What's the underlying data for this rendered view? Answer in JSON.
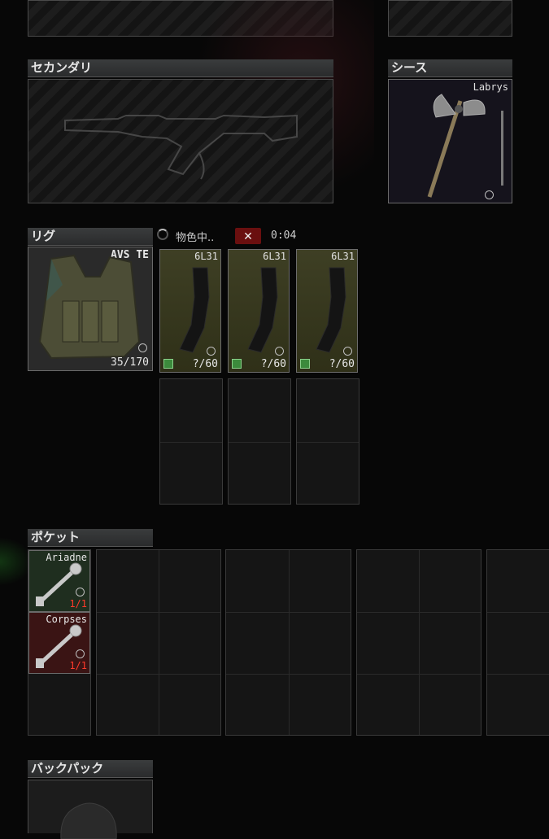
{
  "sections": {
    "secondary": {
      "title": "セカンダリ"
    },
    "sheath": {
      "title": "シース",
      "item_name": "Labrys"
    },
    "rig": {
      "title": "リグ",
      "item_name": "AVS TE",
      "capacity": "35/170"
    },
    "pockets": {
      "title": "ポケット"
    },
    "backpack": {
      "title": "バックパック"
    }
  },
  "search": {
    "status_text": "物色中..",
    "timer": "0:04",
    "cancel_icon": "close-icon"
  },
  "magazines": [
    {
      "name": "6L31",
      "count": "?/60"
    },
    {
      "name": "6L31",
      "count": "?/60"
    },
    {
      "name": "6L31",
      "count": "?/60"
    }
  ],
  "pocket_items": [
    {
      "name": "Ariadne",
      "count": "1/1"
    },
    {
      "name": "Corpses",
      "count": "1/1"
    }
  ],
  "colors": {
    "accent_red": "#ff3a2a",
    "cancel_bg": "#6a0f0f",
    "magazine_bg": "#3e3f24",
    "key_red_bg": "#3a1414"
  }
}
